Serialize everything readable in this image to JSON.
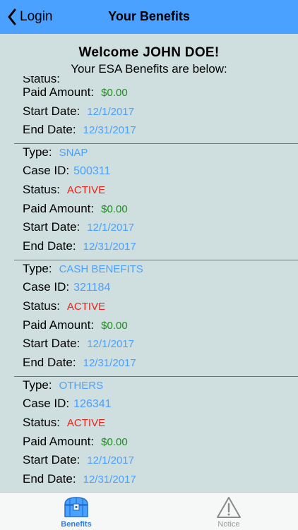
{
  "navbar": {
    "back_label": "Login",
    "title": "Your Benefits"
  },
  "header": {
    "welcome": "Welcome JOHN DOE!",
    "subtitle": "Your ESA Benefits are below:"
  },
  "labels": {
    "type": "Type:",
    "case_id": "Case ID:",
    "status": "Status:",
    "paid_amount": "Paid Amount:",
    "start_date": "Start Date:",
    "end_date": "End Date:"
  },
  "partial_entry": {
    "status_label_cut": "Status:",
    "paid_amount": "$0.00",
    "start_date": "12/1/2017",
    "end_date": "12/31/2017"
  },
  "benefits": [
    {
      "type": "SNAP",
      "case_id": "500311",
      "status": "ACTIVE",
      "paid_amount": "$0.00",
      "start_date": "12/1/2017",
      "end_date": "12/31/2017"
    },
    {
      "type": "CASH BENEFITS",
      "case_id": "321184",
      "status": "ACTIVE",
      "paid_amount": "$0.00",
      "start_date": "12/1/2017",
      "end_date": "12/31/2017"
    },
    {
      "type": "OTHERS",
      "case_id": "126341",
      "status": "ACTIVE",
      "paid_amount": "$0.00",
      "start_date": "12/1/2017",
      "end_date": "12/31/2017"
    }
  ],
  "tabbar": {
    "tabs": [
      {
        "label": "Benefits",
        "icon": "treasure-chest-icon",
        "active": true
      },
      {
        "label": "Notice",
        "icon": "warning-triangle-icon",
        "active": false
      }
    ]
  },
  "colors": {
    "navbar": "#4aa1ff",
    "background": "#cfdede",
    "value_blue": "#4aa1ff",
    "status_red": "#e8241c",
    "amount_green": "#1b8f1b",
    "tab_active": "#2f7fe0",
    "tab_inactive": "#9a9a9a"
  }
}
